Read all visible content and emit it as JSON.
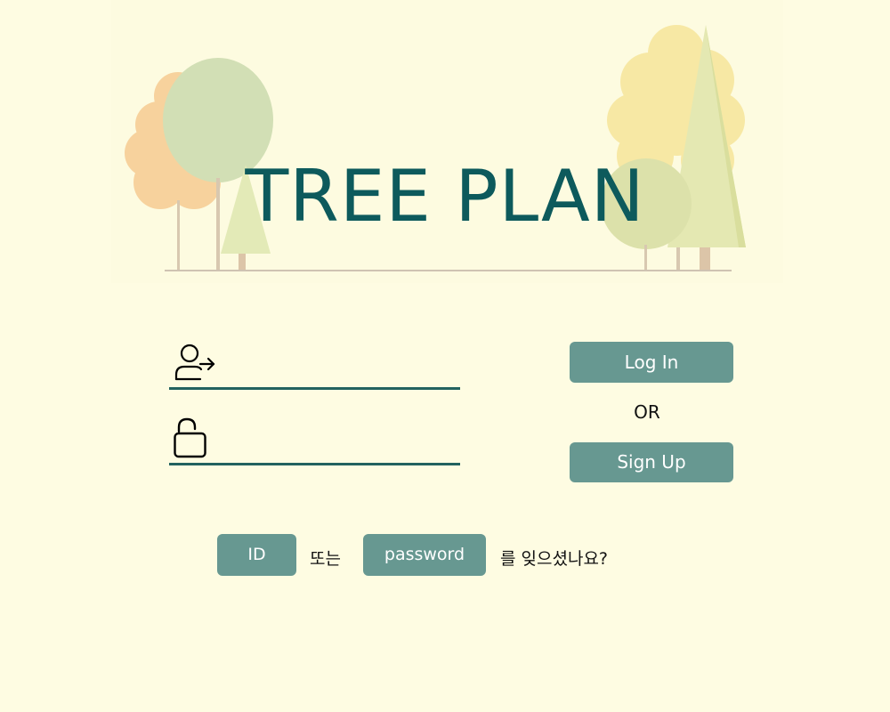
{
  "app": {
    "title": "TREE PLAN"
  },
  "login_form": {
    "id_icon": "user-arrow-icon",
    "password_icon": "unlocked-padlock-icon",
    "id_value": "",
    "password_value": ""
  },
  "actions": {
    "login_label": "Log In",
    "or_label": "OR",
    "signup_label": "Sign Up"
  },
  "recovery": {
    "id_label": "ID",
    "connector_text": "또는",
    "password_label": "password",
    "question_text": "를 잊으셨나요?"
  },
  "colors": {
    "background": "#FEFCE2",
    "title": "#0D5A5C",
    "button": "#679891",
    "button_text": "#FFFFFF",
    "underline": "#22625F"
  }
}
